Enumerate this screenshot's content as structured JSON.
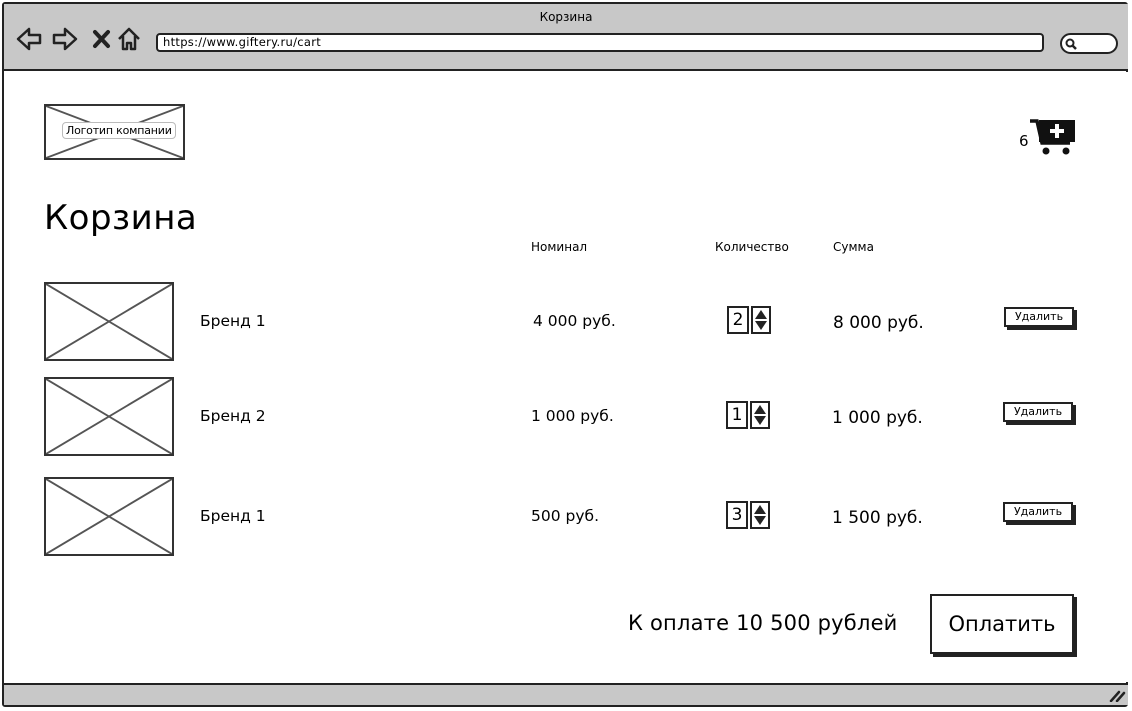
{
  "window": {
    "title": "Корзина",
    "url": "https://www.giftery.ru/cart"
  },
  "header": {
    "logo_label": "Логотип компании",
    "cart_count": "6"
  },
  "page_title": "Корзина",
  "columns": {
    "nominal": "Номинал",
    "quantity": "Количество",
    "sum": "Сумма"
  },
  "items": [
    {
      "brand": "Бренд 1",
      "nominal": "4 000 руб.",
      "quantity": "2",
      "sum": "8 000 руб.",
      "delete_label": "Удалить"
    },
    {
      "brand": "Бренд 2",
      "nominal": "1 000 руб.",
      "quantity": "1",
      "sum": "1 000 руб.",
      "delete_label": "Удалить"
    },
    {
      "brand": "Бренд 1",
      "nominal": "500 руб.",
      "quantity": "3",
      "sum": "1 500 руб.",
      "delete_label": "Удалить"
    }
  ],
  "summary": {
    "total_text": "К оплате 10 500 рублей",
    "pay_label": "Оплатить"
  }
}
